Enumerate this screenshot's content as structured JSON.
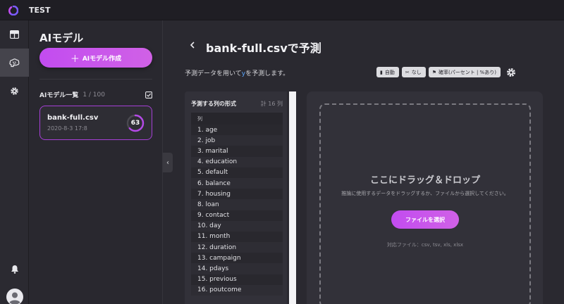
{
  "app": {
    "title": "TEST"
  },
  "sidebar": {
    "title": "AIモデル",
    "create_button": "AIモデル作成",
    "list_label": "AIモデル一覧",
    "list_count": "1 / 100",
    "models": [
      {
        "name": "bank-full.csv",
        "date": "2020-8-3 17:8",
        "score": "63",
        "score_fraction": 0.63
      }
    ]
  },
  "main": {
    "title": "bank-full.csvで予測",
    "description_before": "予測データを用いて",
    "description_target": "y",
    "description_after": "を予測します。",
    "chips": [
      {
        "icon": "document-icon",
        "glyph": "▮",
        "label": "自動"
      },
      {
        "icon": "scissors-icon",
        "glyph": "✂",
        "label": "なし"
      },
      {
        "icon": "flag-icon",
        "glyph": "⚑",
        "label": "確率(パーセント | %あり)"
      }
    ]
  },
  "columns": {
    "title": "予測する列の形式",
    "count": "計 16 列",
    "header": "列",
    "items": [
      "1. age",
      "2. job",
      "3. marital",
      "4. education",
      "5. default",
      "6. balance",
      "7. housing",
      "8. loan",
      "9. contact",
      "10. day",
      "11. month",
      "12. duration",
      "13. campaign",
      "14. pdays",
      "15. previous",
      "16. poutcome"
    ]
  },
  "dropzone": {
    "title": "ここにドラッグ＆ドロップ",
    "subtitle": "推論に使用するデータをドラッグするか、ファイルから選択してください。",
    "button": "ファイルを選択",
    "formats": "対応ファイル：csv, tsv, xls, xlsx"
  },
  "colors": {
    "accent": "#c24cf0",
    "target": "#5aa7ff"
  }
}
